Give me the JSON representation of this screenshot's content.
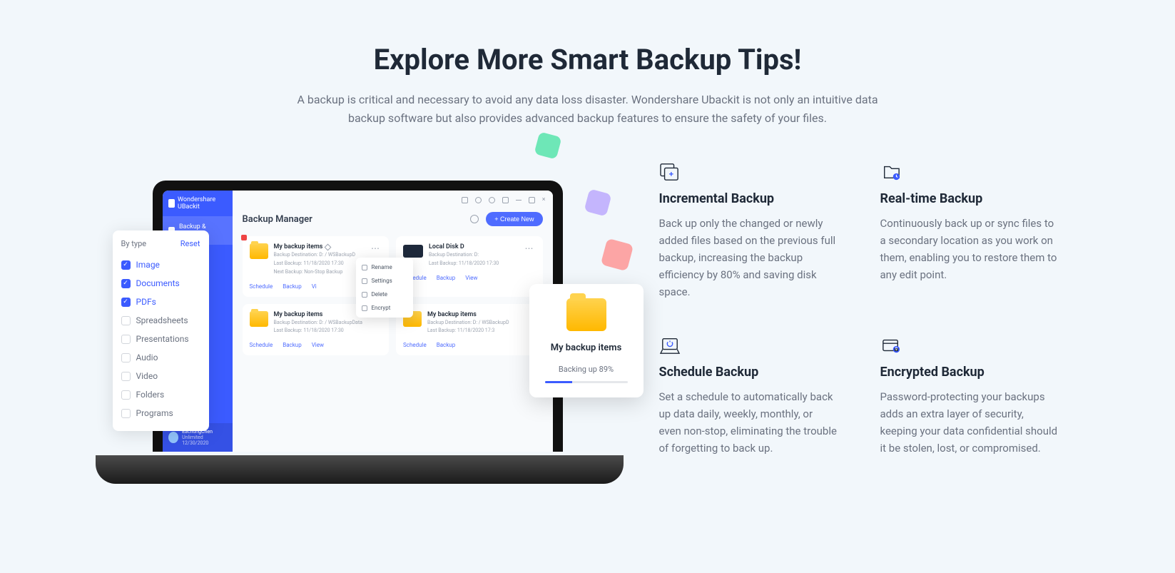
{
  "hero": {
    "title": "Explore More Smart Backup Tips!",
    "desc": "A backup is critical and necessary to avoid any data loss disaster. Wondershare Ubackit is not only an intuitive data backup software but also provides advanced backup features to ensure the safety of your files."
  },
  "app": {
    "brand": "Wondershare UBackit",
    "sidebar_item": "Backup & Restore",
    "user_name": "EachungChen",
    "user_status": "Unlimited 12/30/2020",
    "title": "Backup Manager",
    "create_button": "+ Create New",
    "actions": {
      "schedule": "Schedule",
      "backup": "Backup",
      "view": "View",
      "vi": "Vi"
    }
  },
  "cards": [
    {
      "title": "My backup items",
      "dest": "Backup Destination: D: / WSBackupD",
      "last": "Last Backup: 11/18/2020 17:30",
      "next": "Next Backup: Non-Stop Backup"
    },
    {
      "title": "Local Disk D",
      "dest": "Backup Destination: D:",
      "last": "Last Backup: 11/18/2020 17:30"
    },
    {
      "title": "My backup items",
      "dest": "Backup Destination: D: / WSBackupData",
      "last": "Last Backup: 11/18/2020 17:30"
    },
    {
      "title": "My backup items",
      "dest": "Backup Destination: D: / WSBackupD",
      "last": "Last Backup: 11/18/2020 17:3"
    }
  ],
  "context_menu": [
    "Rename",
    "Settings",
    "Delete",
    "Encrypt"
  ],
  "filter": {
    "title": "By type",
    "reset": "Reset",
    "items": [
      {
        "label": "Image",
        "checked": true
      },
      {
        "label": "Documents",
        "checked": true
      },
      {
        "label": "PDFs",
        "checked": true
      },
      {
        "label": "Spreadsheets",
        "checked": false
      },
      {
        "label": "Presentations",
        "checked": false
      },
      {
        "label": "Audio",
        "checked": false
      },
      {
        "label": "Video",
        "checked": false
      },
      {
        "label": "Folders",
        "checked": false
      },
      {
        "label": "Programs",
        "checked": false
      }
    ]
  },
  "popup": {
    "title": "My backup items",
    "status": "Backing up 89%"
  },
  "features": [
    {
      "title": "Incremental Backup",
      "desc": "Back up only the changed or newly added files based on the previous full backup, increasing the backup efficiency by 80% and saving disk space."
    },
    {
      "title": "Real-time Backup",
      "desc": "Continuously back up or sync files to a secondary location as you work on them, enabling you to restore them to any edit point."
    },
    {
      "title": "Schedule Backup",
      "desc": "Set a schedule to automatically back up data daily, weekly, monthly, or even non-stop, eliminating the trouble of forgetting to back up."
    },
    {
      "title": "Encrypted Backup",
      "desc": "Password-protecting your backups adds an extra layer of security, keeping your data confidential should it be stolen, lost, or compromised."
    }
  ]
}
